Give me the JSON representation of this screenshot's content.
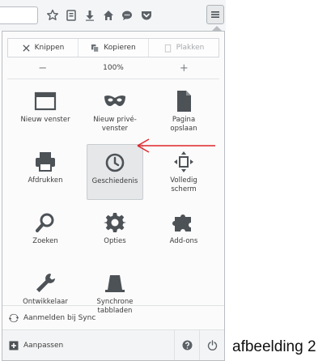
{
  "toolbar": {
    "icons": [
      "star-icon",
      "bookmarks-list-icon",
      "download-icon",
      "home-icon",
      "chat-icon",
      "pocket-icon",
      "hamburger-menu-icon"
    ]
  },
  "panel": {
    "edit": {
      "cut_label": "Knippen",
      "copy_label": "Kopieren",
      "paste_label": "Plakken"
    },
    "zoom": {
      "minus": "−",
      "level": "100%",
      "plus": "+"
    },
    "items": [
      {
        "label": "Nieuw venster",
        "icon": "new-window-icon"
      },
      {
        "label": "Nieuw privé-\nvenster",
        "icon": "private-mask-icon"
      },
      {
        "label": "Pagina\nopslaan",
        "icon": "save-page-icon"
      },
      {
        "label": "Afdrukken",
        "icon": "printer-icon"
      },
      {
        "label": "Geschiedenis",
        "icon": "history-clock-icon"
      },
      {
        "label": "Volledig\nscherm",
        "icon": "fullscreen-icon"
      },
      {
        "label": "Zoeken",
        "icon": "search-icon"
      },
      {
        "label": "Opties",
        "icon": "gear-icon"
      },
      {
        "label": "Add-ons",
        "icon": "puzzle-icon"
      },
      {
        "label": "Ontwikkelaar",
        "icon": "wrench-icon"
      },
      {
        "label": "Synchrone\ntabbladen",
        "icon": "sync-tabs-icon"
      }
    ],
    "sync_label": "Aanmelden bij Sync",
    "customize_label": "Aanpassen",
    "active_item": "Geschiedenis"
  },
  "annotation": {
    "caption": "afbeelding 2",
    "arrow_color": "#e0262a"
  }
}
